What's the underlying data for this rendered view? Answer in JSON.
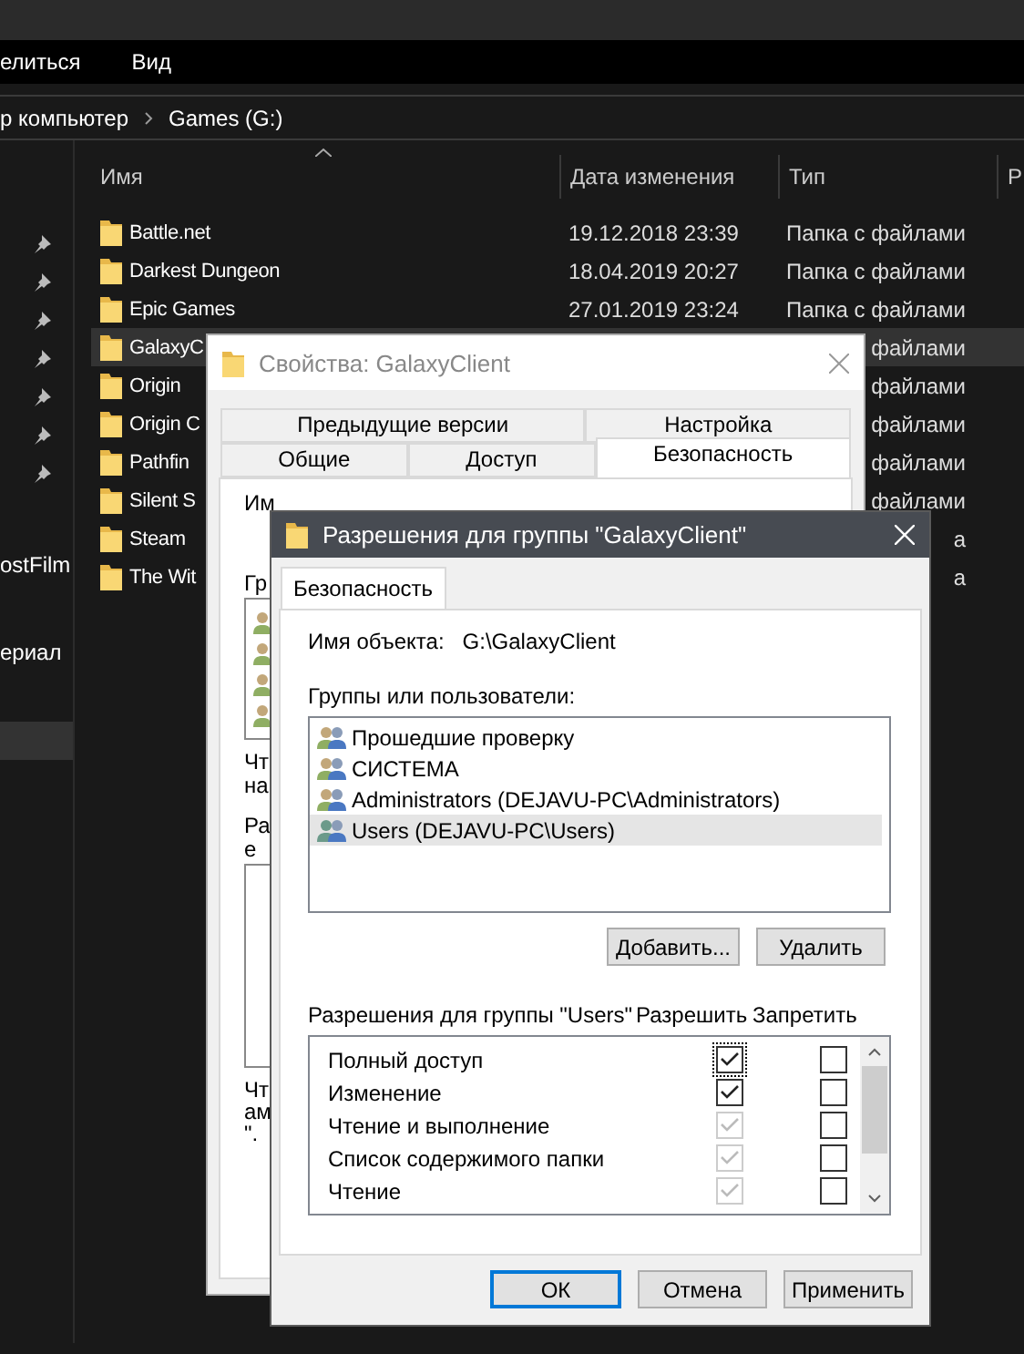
{
  "explorer": {
    "ribbon": [
      "елиться",
      "Вид"
    ],
    "breadcrumb": [
      "р компьютер",
      "Games (G:)"
    ],
    "sidebar": {
      "items": [
        {
          "label": "ostFilm",
          "selected": false
        },
        {
          "label": "ериал",
          "selected": false
        },
        {
          "selected": true
        }
      ]
    },
    "columns": [
      "Имя",
      "Дата изменения",
      "Тип",
      "Р"
    ],
    "rows": [
      {
        "name": "Battle.net",
        "date": "19.12.2018 23:39",
        "type": "Папка с файлами",
        "selected": false
      },
      {
        "name": "Darkest Dungeon",
        "date": "18.04.2019 20:27",
        "type": "Папка с файлами",
        "selected": false
      },
      {
        "name": "Epic Games",
        "date": "27.01.2019 23:24",
        "type": "Папка с файлами",
        "selected": false
      },
      {
        "name": "GalaxyC",
        "type": "файлами",
        "selected": true
      },
      {
        "name": "Origin",
        "type": "файлами",
        "selected": false
      },
      {
        "name": "Origin C",
        "type": "файлами",
        "selected": false
      },
      {
        "name": "Pathfin",
        "type": "файлами",
        "selected": false
      },
      {
        "name": "Silent S",
        "type": "файлами",
        "selected": false
      },
      {
        "name": "Steam",
        "type": "а",
        "selected": false
      },
      {
        "name": "The Wit",
        "type": "а",
        "selected": false
      }
    ]
  },
  "properties": {
    "title": "Свойства: GalaxyClient",
    "tab_rows": [
      [
        {
          "label": "Предыдущие версии",
          "selected": false
        },
        {
          "label": "Настройка",
          "selected": false
        }
      ],
      [
        {
          "label": "Общие",
          "selected": false
        },
        {
          "label": "Доступ",
          "selected": false
        },
        {
          "label": "Безопасность",
          "selected": true
        }
      ]
    ],
    "fragments": [
      "Им",
      "Гр",
      "Чт",
      "на",
      "Ра",
      "е",
      "Чт",
      "ам",
      "\"."
    ]
  },
  "permissions": {
    "title": "Разрешения для группы \"GalaxyClient\"",
    "tab": "Безопасность",
    "object_label": "Имя объекта:",
    "object_value": "G:\\GalaxyClient",
    "groups_label": "Группы или пользователи:",
    "groups": [
      {
        "name": "Прошедшие проверку",
        "selected": false
      },
      {
        "name": "СИСТЕМА",
        "selected": false
      },
      {
        "name": "Administrators (DEJAVU-PC\\Administrators)",
        "selected": false
      },
      {
        "name": "Users (DEJAVU-PC\\Users)",
        "selected": true
      }
    ],
    "group_buttons": [
      "Добавить...",
      "Удалить"
    ],
    "perm_header": "Разрешения для группы \"Users\"",
    "allow_header": "Разрешить",
    "deny_header": "Запретить",
    "perms": [
      {
        "name": "Полный доступ",
        "allow": true,
        "allow_disabled": false,
        "focused": true,
        "deny": false
      },
      {
        "name": "Изменение",
        "allow": true,
        "allow_disabled": false,
        "focused": false,
        "deny": false
      },
      {
        "name": "Чтение и выполнение",
        "allow": true,
        "allow_disabled": true,
        "focused": false,
        "deny": false
      },
      {
        "name": "Список содержимого папки",
        "allow": true,
        "allow_disabled": true,
        "focused": false,
        "deny": false
      },
      {
        "name": "Чтение",
        "allow": true,
        "allow_disabled": true,
        "focused": false,
        "deny": false
      }
    ],
    "buttons": [
      {
        "label": "ОК",
        "default": true
      },
      {
        "label": "Отмена",
        "default": false
      },
      {
        "label": "Применить",
        "default": false
      }
    ]
  }
}
